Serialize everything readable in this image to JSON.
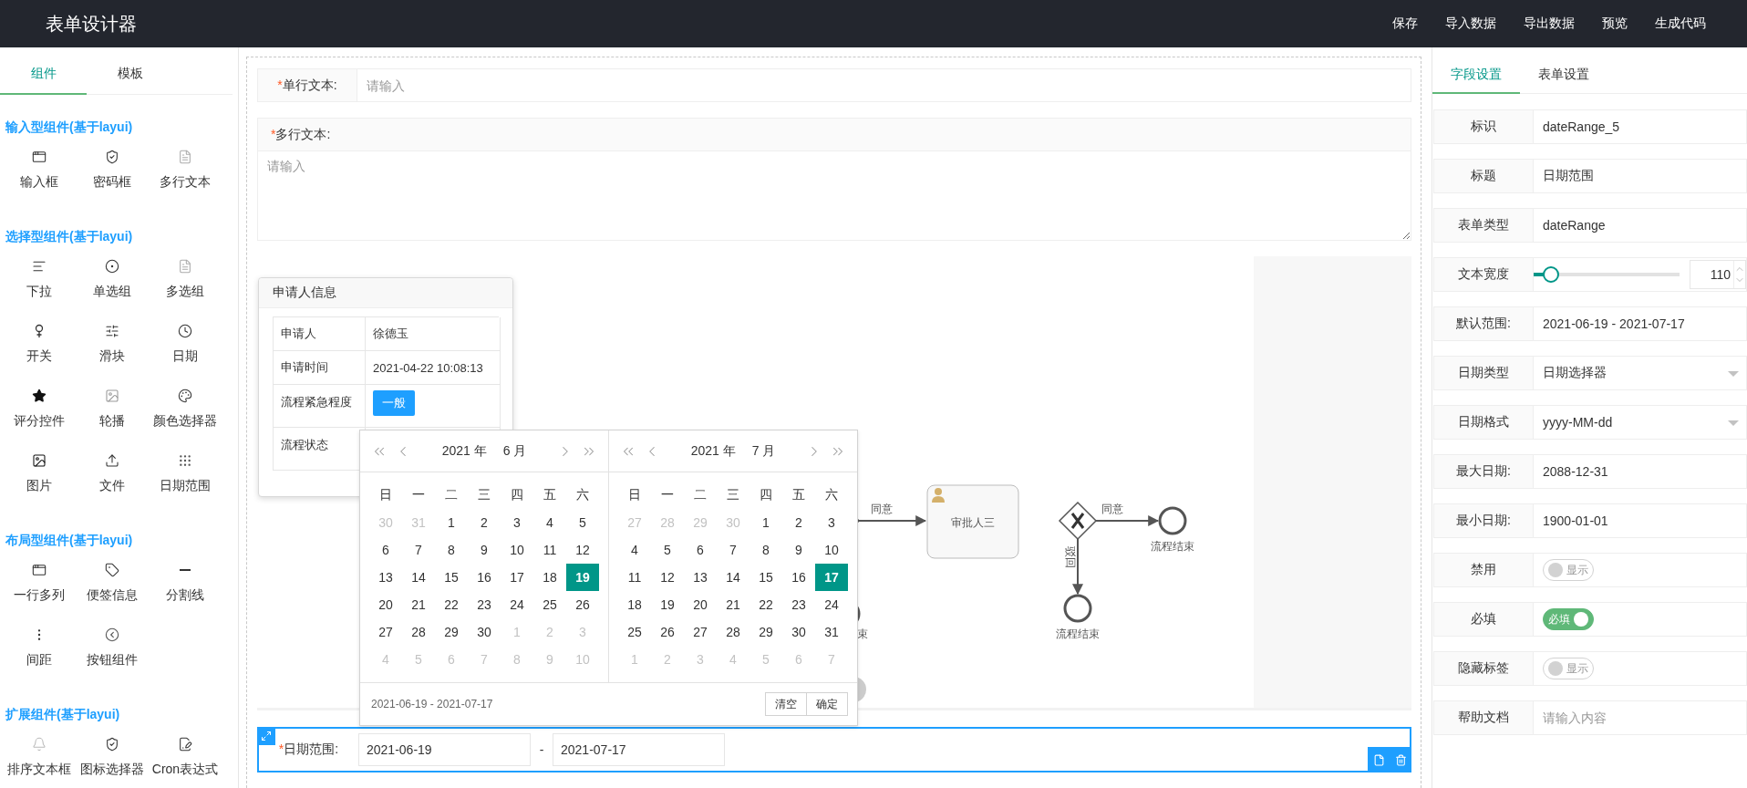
{
  "header": {
    "title": "表单设计器",
    "menu": [
      "保存",
      "导入数据",
      "导出数据",
      "预览",
      "生成代码"
    ]
  },
  "sidebar": {
    "tabs": [
      {
        "label": "组件",
        "selected": true
      },
      {
        "label": "模板",
        "selected": false
      }
    ],
    "groups": [
      {
        "title": "输入型组件(基于layui)",
        "items": [
          "输入框",
          "密码框",
          "多行文本"
        ]
      },
      {
        "title": "选择型组件(基于layui)",
        "items": [
          "下拉",
          "单选组",
          "多选组",
          "开关",
          "滑块",
          "日期",
          "评分控件",
          "轮播",
          "颜色选择器",
          "图片",
          "文件",
          "日期范围"
        ]
      },
      {
        "title": "布局型组件(基于layui)",
        "items": [
          "一行多列",
          "便签信息",
          "分割线",
          "间距",
          "按钮组件"
        ]
      },
      {
        "title": "扩展组件(基于layui)",
        "items": [
          "排序文本框",
          "图标选择器",
          "Cron表达式"
        ]
      }
    ]
  },
  "form": {
    "fields": [
      {
        "kind": "text",
        "mark": "*",
        "label": "单行文本:",
        "placeholder": "请输入"
      },
      {
        "kind": "textarea",
        "mark": "*",
        "label": "多行文本:",
        "placeholder": "请输入"
      }
    ],
    "flow": {
      "card": {
        "title": "申请人信息",
        "rows": [
          {
            "label": "申请人",
            "value": "徐德玉"
          },
          {
            "label": "申请时间",
            "value": "2021-04-22 10:08:13"
          },
          {
            "label": "流程紧急程度",
            "tag": "一般"
          },
          {
            "label": "流程状态"
          }
        ]
      },
      "diagram": {
        "edge_labels": [
          "同意",
          "同意",
          "驳回"
        ],
        "node_labels": [
          "审批人三",
          "流程结束",
          "流程结束",
          "束"
        ]
      }
    },
    "calendar": {
      "panels": [
        {
          "year": "2021 年",
          "month": "6 月",
          "weekdays": [
            "日",
            "一",
            "二",
            "三",
            "四",
            "五",
            "六"
          ],
          "weeks": [
            [
              {
                "d": "30",
                "muted": true,
                "selected": false
              },
              {
                "d": "31",
                "muted": true,
                "selected": false
              },
              {
                "d": "1",
                "muted": false,
                "selected": false
              },
              {
                "d": "2",
                "muted": false,
                "selected": false
              },
              {
                "d": "3",
                "muted": false,
                "selected": false
              },
              {
                "d": "4",
                "muted": false,
                "selected": false
              },
              {
                "d": "5",
                "muted": false,
                "selected": false
              }
            ],
            [
              {
                "d": "6",
                "muted": false,
                "selected": false
              },
              {
                "d": "7",
                "muted": false,
                "selected": false
              },
              {
                "d": "8",
                "muted": false,
                "selected": false
              },
              {
                "d": "9",
                "muted": false,
                "selected": false
              },
              {
                "d": "10",
                "muted": false,
                "selected": false
              },
              {
                "d": "11",
                "muted": false,
                "selected": false
              },
              {
                "d": "12",
                "muted": false,
                "selected": false
              }
            ],
            [
              {
                "d": "13",
                "muted": false,
                "selected": false
              },
              {
                "d": "14",
                "muted": false,
                "selected": false
              },
              {
                "d": "15",
                "muted": false,
                "selected": false
              },
              {
                "d": "16",
                "muted": false,
                "selected": false
              },
              {
                "d": "17",
                "muted": false,
                "selected": false
              },
              {
                "d": "18",
                "muted": false,
                "selected": false
              },
              {
                "d": "19",
                "muted": false,
                "selected": true
              }
            ],
            [
              {
                "d": "20",
                "muted": false,
                "selected": false
              },
              {
                "d": "21",
                "muted": false,
                "selected": false
              },
              {
                "d": "22",
                "muted": false,
                "selected": false
              },
              {
                "d": "23",
                "muted": false,
                "selected": false
              },
              {
                "d": "24",
                "muted": false,
                "selected": false
              },
              {
                "d": "25",
                "muted": false,
                "selected": false
              },
              {
                "d": "26",
                "muted": false,
                "selected": false
              }
            ],
            [
              {
                "d": "27",
                "muted": false,
                "selected": false
              },
              {
                "d": "28",
                "muted": false,
                "selected": false
              },
              {
                "d": "29",
                "muted": false,
                "selected": false
              },
              {
                "d": "30",
                "muted": false,
                "selected": false
              },
              {
                "d": "1",
                "muted": true,
                "selected": false
              },
              {
                "d": "2",
                "muted": true,
                "selected": false
              },
              {
                "d": "3",
                "muted": true,
                "selected": false
              }
            ],
            [
              {
                "d": "4",
                "muted": true,
                "selected": false
              },
              {
                "d": "5",
                "muted": true,
                "selected": false
              },
              {
                "d": "6",
                "muted": true,
                "selected": false
              },
              {
                "d": "7",
                "muted": true,
                "selected": false
              },
              {
                "d": "8",
                "muted": true,
                "selected": false
              },
              {
                "d": "9",
                "muted": true,
                "selected": false
              },
              {
                "d": "10",
                "muted": true,
                "selected": false
              }
            ]
          ]
        },
        {
          "year": "2021 年",
          "month": "7 月",
          "weekdays": [
            "日",
            "一",
            "二",
            "三",
            "四",
            "五",
            "六"
          ],
          "weeks": [
            [
              {
                "d": "27",
                "muted": true,
                "selected": false
              },
              {
                "d": "28",
                "muted": true,
                "selected": false
              },
              {
                "d": "29",
                "muted": true,
                "selected": false
              },
              {
                "d": "30",
                "muted": true,
                "selected": false
              },
              {
                "d": "1",
                "muted": false,
                "selected": false
              },
              {
                "d": "2",
                "muted": false,
                "selected": false
              },
              {
                "d": "3",
                "muted": false,
                "selected": false
              }
            ],
            [
              {
                "d": "4",
                "muted": false,
                "selected": false
              },
              {
                "d": "5",
                "muted": false,
                "selected": false
              },
              {
                "d": "6",
                "muted": false,
                "selected": false
              },
              {
                "d": "7",
                "muted": false,
                "selected": false
              },
              {
                "d": "8",
                "muted": false,
                "selected": false
              },
              {
                "d": "9",
                "muted": false,
                "selected": false
              },
              {
                "d": "10",
                "muted": false,
                "selected": false
              }
            ],
            [
              {
                "d": "11",
                "muted": false,
                "selected": false
              },
              {
                "d": "12",
                "muted": false,
                "selected": false
              },
              {
                "d": "13",
                "muted": false,
                "selected": false
              },
              {
                "d": "14",
                "muted": false,
                "selected": false
              },
              {
                "d": "15",
                "muted": false,
                "selected": false
              },
              {
                "d": "16",
                "muted": false,
                "selected": false
              },
              {
                "d": "17",
                "muted": false,
                "selected": true
              }
            ],
            [
              {
                "d": "18",
                "muted": false,
                "selected": false
              },
              {
                "d": "19",
                "muted": false,
                "selected": false
              },
              {
                "d": "20",
                "muted": false,
                "selected": false
              },
              {
                "d": "21",
                "muted": false,
                "selected": false
              },
              {
                "d": "22",
                "muted": false,
                "selected": false
              },
              {
                "d": "23",
                "muted": false,
                "selected": false
              },
              {
                "d": "24",
                "muted": false,
                "selected": false
              }
            ],
            [
              {
                "d": "25",
                "muted": false,
                "selected": false
              },
              {
                "d": "26",
                "muted": false,
                "selected": false
              },
              {
                "d": "27",
                "muted": false,
                "selected": false
              },
              {
                "d": "28",
                "muted": false,
                "selected": false
              },
              {
                "d": "29",
                "muted": false,
                "selected": false
              },
              {
                "d": "30",
                "muted": false,
                "selected": false
              },
              {
                "d": "31",
                "muted": false,
                "selected": false
              }
            ],
            [
              {
                "d": "1",
                "muted": true,
                "selected": false
              },
              {
                "d": "2",
                "muted": true,
                "selected": false
              },
              {
                "d": "3",
                "muted": true,
                "selected": false
              },
              {
                "d": "4",
                "muted": true,
                "selected": false
              },
              {
                "d": "5",
                "muted": true,
                "selected": false
              },
              {
                "d": "6",
                "muted": true,
                "selected": false
              },
              {
                "d": "7",
                "muted": true,
                "selected": false
              }
            ]
          ]
        }
      ],
      "range": "2021-06-19 - 2021-07-17",
      "buttons": [
        "清空",
        "确定"
      ]
    },
    "date_range": {
      "mark": "*",
      "label": "日期范围:",
      "start": "2021-06-19",
      "separator": "-",
      "end": "2021-07-17",
      "selected": true
    }
  },
  "settings": {
    "tabs": [
      {
        "label": "字段设置",
        "selected": true
      },
      {
        "label": "表单设置",
        "selected": false
      }
    ],
    "rows": [
      {
        "kind": "text",
        "label": "标识",
        "value": "dateRange_5"
      },
      {
        "kind": "text",
        "label": "标题",
        "value": "日期范围"
      },
      {
        "kind": "text",
        "label": "表单类型",
        "value": "dateRange"
      },
      {
        "kind": "slider",
        "label": "文本宽度",
        "level": 0.12,
        "value": "110"
      },
      {
        "kind": "text",
        "label": "默认范围:",
        "value": "2021-06-19 - 2021-07-17"
      },
      {
        "kind": "select",
        "label": "日期类型",
        "value": "日期选择器"
      },
      {
        "kind": "select",
        "label": "日期格式",
        "value": "yyyy-MM-dd"
      },
      {
        "kind": "text",
        "label": "最大日期:",
        "value": "2088-12-31"
      },
      {
        "kind": "text",
        "label": "最小日期:",
        "value": "1900-01-01"
      },
      {
        "kind": "switch",
        "label": "禁用",
        "on": false,
        "text": "显示"
      },
      {
        "kind": "switch",
        "label": "必填",
        "on": true,
        "text": "必填"
      },
      {
        "kind": "switch",
        "label": "隐藏标签",
        "on": false,
        "text": "显示"
      },
      {
        "kind": "input",
        "label": "帮助文档",
        "placeholder": "请输入内容"
      }
    ]
  }
}
